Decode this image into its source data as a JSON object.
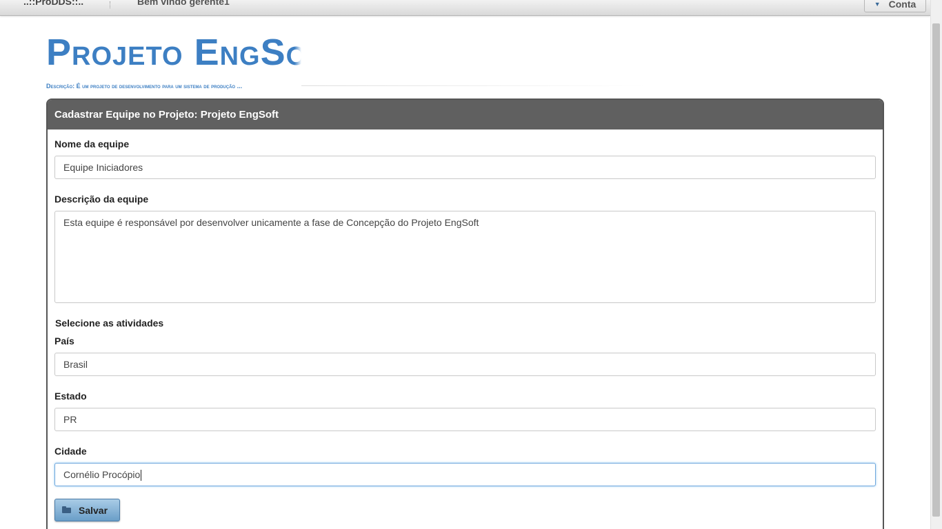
{
  "topbar": {
    "brand": "..::ProDDS::..",
    "welcome": "Bem vindo gerente1",
    "account_label": "Conta"
  },
  "header": {
    "logo_text": "Projeto EngSoft",
    "description": "Descrição: É um projeto de desenvolvimento para um sistema de produção ..."
  },
  "panel": {
    "title": "Cadastrar Equipe no Projeto: Projeto EngSoft"
  },
  "form": {
    "team_name_label": "Nome da equipe",
    "team_name_value": "Equipe Iniciadores",
    "team_description_label": "Descrição da equipe",
    "team_description_value": "Esta equipe é responsável por desenvolver unicamente a fase de Concepção do Projeto EngSoft",
    "activities_label": "Selecione as atividades",
    "country_label": "País",
    "country_value": "Brasil",
    "state_label": "Estado",
    "state_value": "PR",
    "city_label": "Cidade",
    "city_value": "Cornélio Procópio",
    "save_label": "Salvar"
  },
  "colors": {
    "accent": "#3d7fc3",
    "panel_header": "#606060",
    "button": "#8bb6d9"
  }
}
